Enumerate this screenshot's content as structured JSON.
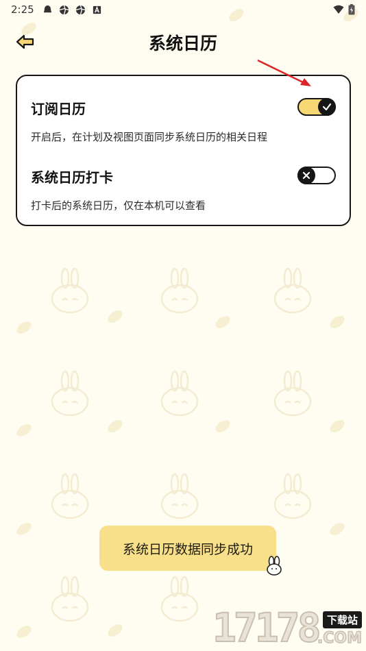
{
  "status_bar": {
    "time": "2:25",
    "icons": [
      "qq-bell-icon",
      "aperture-icon",
      "aperture-icon",
      "font-a-icon"
    ],
    "right_icons": [
      "wifi-icon",
      "battery-icon"
    ]
  },
  "header": {
    "back_icon": "back-arrow-icon",
    "title": "系统日历"
  },
  "settings": [
    {
      "title": "订阅日历",
      "description": "开启后，在计划及视图页面同步系统日历的相关日程",
      "enabled": true,
      "knob_icon": "check-icon"
    },
    {
      "title": "系统日历打卡",
      "description": "打卡后的系统日历，仅在本机可以查看",
      "enabled": false,
      "knob_icon": "x-icon"
    }
  ],
  "toast": {
    "text": "系统日历数据同步成功"
  },
  "watermark": {
    "digits": "17178",
    "badge": "下载站",
    "domain": ".COM"
  },
  "colors": {
    "background": "#fffdf2",
    "accent_yellow": "#f8d874",
    "toast_bg": "#f8df8a",
    "border": "#161616",
    "annotation_arrow": "#d8262b"
  }
}
